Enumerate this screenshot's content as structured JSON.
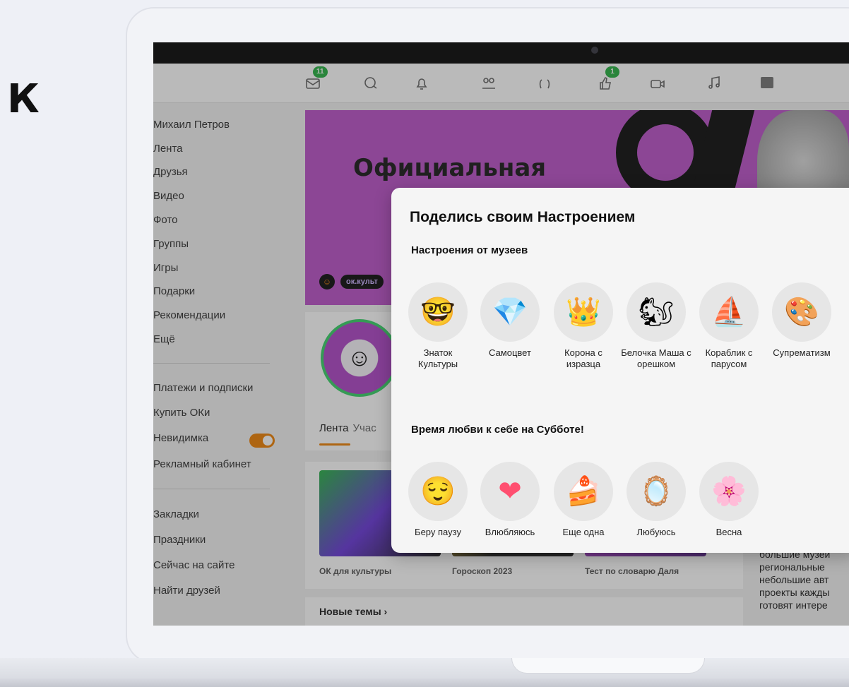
{
  "side_letter": "К",
  "topbar": {
    "messages_badge": "11",
    "likes_badge": "1",
    "icons": [
      "mail-icon",
      "chat-icon",
      "bell-icon",
      "friends-icon",
      "guests-icon",
      "thumbs-up-icon",
      "video-icon",
      "music-icon"
    ]
  },
  "sidebar": {
    "user_name": "Михаил Петров",
    "main_items": [
      "Лента",
      "Друзья",
      "Видео",
      "Фото",
      "Группы",
      "Игры",
      "Подарки",
      "Рекомендации",
      "Ещё"
    ],
    "account_items": [
      "Платежи и подписки",
      "Купить ОКи",
      "Невидимка",
      "Рекламный кабинет"
    ],
    "extra_items": [
      "Закладки",
      "Праздники",
      "Сейчас на сайте",
      "Найти друзей"
    ]
  },
  "banner": {
    "title": "Официальная",
    "tag": "ок.культ"
  },
  "group": {
    "tabs": [
      "Лента",
      "Учас"
    ]
  },
  "feed": {
    "captions": [
      "ОК для культуры",
      "Гороскоп 2023",
      "Тест по словарю Даля"
    ],
    "new_topics": "Новые темы ›"
  },
  "right_text": "большие музеи региональные небольшие авт проекты кажды готовят интере",
  "modal": {
    "title": "Поделись своим Настроением",
    "section1": "Настроения от музеев",
    "section2": "Время любви к себе на Субботе!",
    "museum_moods": [
      {
        "label": "Знаток Культуры",
        "icon": "🤓",
        "icon_name": "nerd-face-icon"
      },
      {
        "label": "Самоцвет",
        "icon": "💎",
        "icon_name": "gem-icon"
      },
      {
        "label": "Корона с изразца",
        "icon": "👑",
        "icon_name": "crown-icon"
      },
      {
        "label": "Белочка Маша с орешком",
        "icon": "🐿",
        "icon_name": "squirrel-icon"
      },
      {
        "label": "Кораблик с парусом",
        "icon": "⛵",
        "icon_name": "sailboat-icon"
      },
      {
        "label": "Супрематизм",
        "icon": "🎨",
        "icon_name": "suprematism-icon"
      }
    ],
    "love_moods": [
      {
        "label": "Беру паузу",
        "icon": "😌",
        "icon_name": "pillow-icon"
      },
      {
        "label": "Влюбляюсь",
        "icon": "❤",
        "icon_name": "heart-icon"
      },
      {
        "label": "Еще одна",
        "icon": "🍰",
        "icon_name": "cake-icon"
      },
      {
        "label": "Любуюсь",
        "icon": "🪞",
        "icon_name": "mirror-icon"
      },
      {
        "label": "Весна",
        "icon": "🌸",
        "icon_name": "flower-icon"
      }
    ]
  }
}
